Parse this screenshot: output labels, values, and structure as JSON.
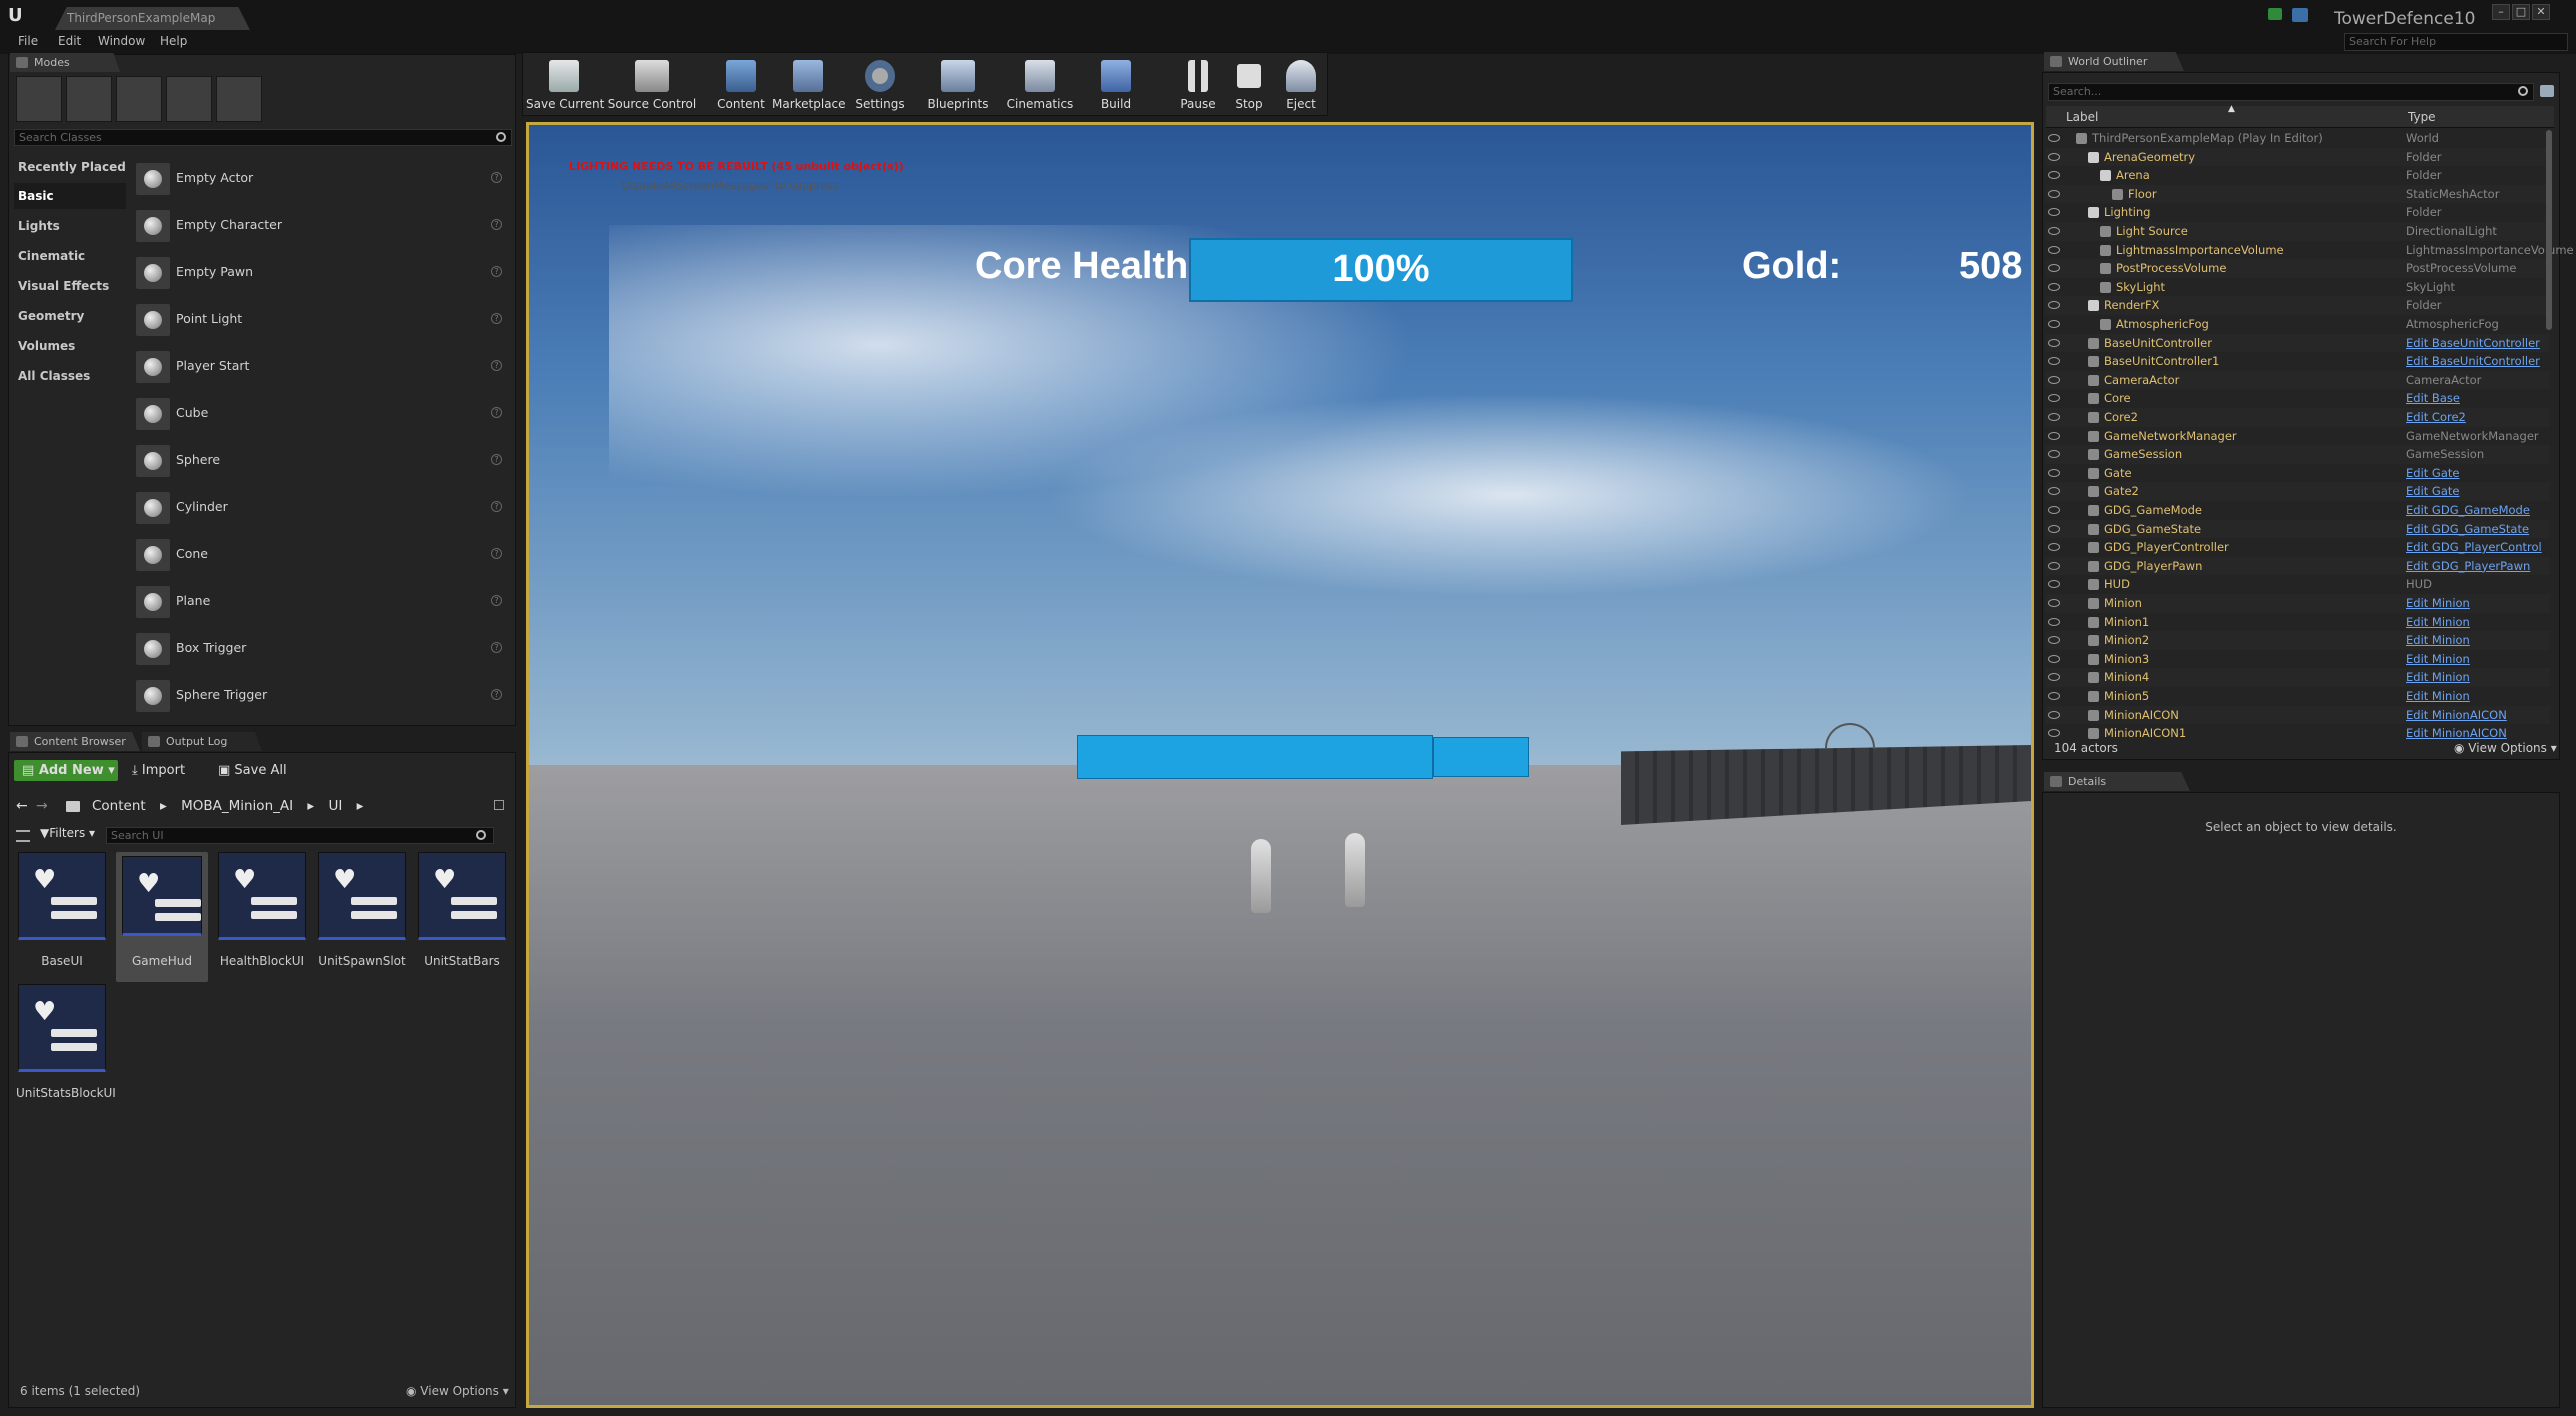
{
  "app": {
    "map_tab": "ThirdPersonExampleMap",
    "project": "TowerDefence10",
    "help_search_placeholder": "Search For Help",
    "menus": [
      "File",
      "Edit",
      "Window",
      "Help"
    ]
  },
  "modes": {
    "tab": "Modes",
    "search_placeholder": "Search Classes",
    "categories": [
      "Recently Placed",
      "Basic",
      "Lights",
      "Cinematic",
      "Visual Effects",
      "Geometry",
      "Volumes",
      "All Classes"
    ],
    "selected_category": "Basic",
    "items": [
      "Empty Actor",
      "Empty Character",
      "Empty Pawn",
      "Point Light",
      "Player Start",
      "Cube",
      "Sphere",
      "Cylinder",
      "Cone",
      "Plane",
      "Box Trigger",
      "Sphere Trigger"
    ]
  },
  "content_browser": {
    "tabs": [
      "Content Browser",
      "Output Log"
    ],
    "add_new": "Add New",
    "import": "Import",
    "save_all": "Save All",
    "path": [
      "Content",
      "MOBA_Minion_AI",
      "UI"
    ],
    "filters": "Filters",
    "search_placeholder": "Search UI",
    "assets": [
      "BaseUI",
      "GameHud",
      "HealthBlockUI",
      "UnitSpawnSlot",
      "UnitStatBars",
      "UnitStatsBlockUI"
    ],
    "selected_asset": "GameHud",
    "status": "6 items (1 selected)",
    "view_options": "View Options"
  },
  "toolbar": {
    "buttons": [
      "Save Current",
      "Source Control",
      "Content",
      "Marketplace",
      "Settings",
      "Blueprints",
      "Cinematics",
      "Build",
      "Pause",
      "Stop",
      "Eject"
    ]
  },
  "viewport": {
    "warning": "LIGHTING NEEDS TO BE REBUILT (45 unbuilt object(s))",
    "warning_sub": "'DisableAllScreenMessages' to suppress",
    "hud": {
      "health_label": "Core Health:",
      "health_value": "100%",
      "health_fraction": 1.0,
      "gold_label": "Gold:",
      "gold_value": "508"
    }
  },
  "outliner": {
    "tab": "World Outliner",
    "search_placeholder": "Search...",
    "col_label": "Label",
    "col_type": "Type",
    "rows": [
      {
        "label": "ThirdPersonExampleMap (Play In Editor)",
        "type": "World",
        "indent": 0,
        "link": false
      },
      {
        "label": "ArenaGeometry",
        "type": "Folder",
        "indent": 1,
        "link": false
      },
      {
        "label": "Arena",
        "type": "Folder",
        "indent": 2,
        "link": false
      },
      {
        "label": "Floor",
        "type": "StaticMeshActor",
        "indent": 3,
        "link": false
      },
      {
        "label": "Lighting",
        "type": "Folder",
        "indent": 1,
        "link": false
      },
      {
        "label": "Light Source",
        "type": "DirectionalLight",
        "indent": 2,
        "link": false
      },
      {
        "label": "LightmassImportanceVolume",
        "type": "LightmassImportanceVolume",
        "indent": 2,
        "link": false
      },
      {
        "label": "PostProcessVolume",
        "type": "PostProcessVolume",
        "indent": 2,
        "link": false
      },
      {
        "label": "SkyLight",
        "type": "SkyLight",
        "indent": 2,
        "link": false
      },
      {
        "label": "RenderFX",
        "type": "Folder",
        "indent": 1,
        "link": false
      },
      {
        "label": "AtmosphericFog",
        "type": "AtmosphericFog",
        "indent": 2,
        "link": false
      },
      {
        "label": "BaseUnitController",
        "type": "Edit BaseUnitController",
        "indent": 1,
        "link": true
      },
      {
        "label": "BaseUnitController1",
        "type": "Edit BaseUnitController",
        "indent": 1,
        "link": true
      },
      {
        "label": "CameraActor",
        "type": "CameraActor",
        "indent": 1,
        "link": false
      },
      {
        "label": "Core",
        "type": "Edit Base",
        "indent": 1,
        "link": true
      },
      {
        "label": "Core2",
        "type": "Edit Core2",
        "indent": 1,
        "link": true
      },
      {
        "label": "GameNetworkManager",
        "type": "GameNetworkManager",
        "indent": 1,
        "link": false
      },
      {
        "label": "GameSession",
        "type": "GameSession",
        "indent": 1,
        "link": false
      },
      {
        "label": "Gate",
        "type": "Edit Gate",
        "indent": 1,
        "link": true
      },
      {
        "label": "Gate2",
        "type": "Edit Gate",
        "indent": 1,
        "link": true
      },
      {
        "label": "GDG_GameMode",
        "type": "Edit GDG_GameMode",
        "indent": 1,
        "link": true
      },
      {
        "label": "GDG_GameState",
        "type": "Edit GDG_GameState",
        "indent": 1,
        "link": true
      },
      {
        "label": "GDG_PlayerController",
        "type": "Edit GDG_PlayerControl",
        "indent": 1,
        "link": true
      },
      {
        "label": "GDG_PlayerPawn",
        "type": "Edit GDG_PlayerPawn",
        "indent": 1,
        "link": true
      },
      {
        "label": "HUD",
        "type": "HUD",
        "indent": 1,
        "link": false
      },
      {
        "label": "Minion",
        "type": "Edit Minion",
        "indent": 1,
        "link": true
      },
      {
        "label": "Minion1",
        "type": "Edit Minion",
        "indent": 1,
        "link": true
      },
      {
        "label": "Minion2",
        "type": "Edit Minion",
        "indent": 1,
        "link": true
      },
      {
        "label": "Minion3",
        "type": "Edit Minion",
        "indent": 1,
        "link": true
      },
      {
        "label": "Minion4",
        "type": "Edit Minion",
        "indent": 1,
        "link": true
      },
      {
        "label": "Minion5",
        "type": "Edit Minion",
        "indent": 1,
        "link": true
      },
      {
        "label": "MinionAICON",
        "type": "Edit MinionAICON",
        "indent": 1,
        "link": true
      },
      {
        "label": "MinionAICON1",
        "type": "Edit MinionAICON",
        "indent": 1,
        "link": true
      }
    ],
    "count": "104 actors",
    "view_options": "View Options"
  },
  "details": {
    "tab": "Details",
    "empty_text": "Select an object to view details."
  },
  "colors": {
    "hud_bar": "#1e9ad9",
    "viewport_border": "#c5a840",
    "warning": "#dd1111",
    "link": "#6ba3f0",
    "add_new": "#3f8f2f"
  }
}
